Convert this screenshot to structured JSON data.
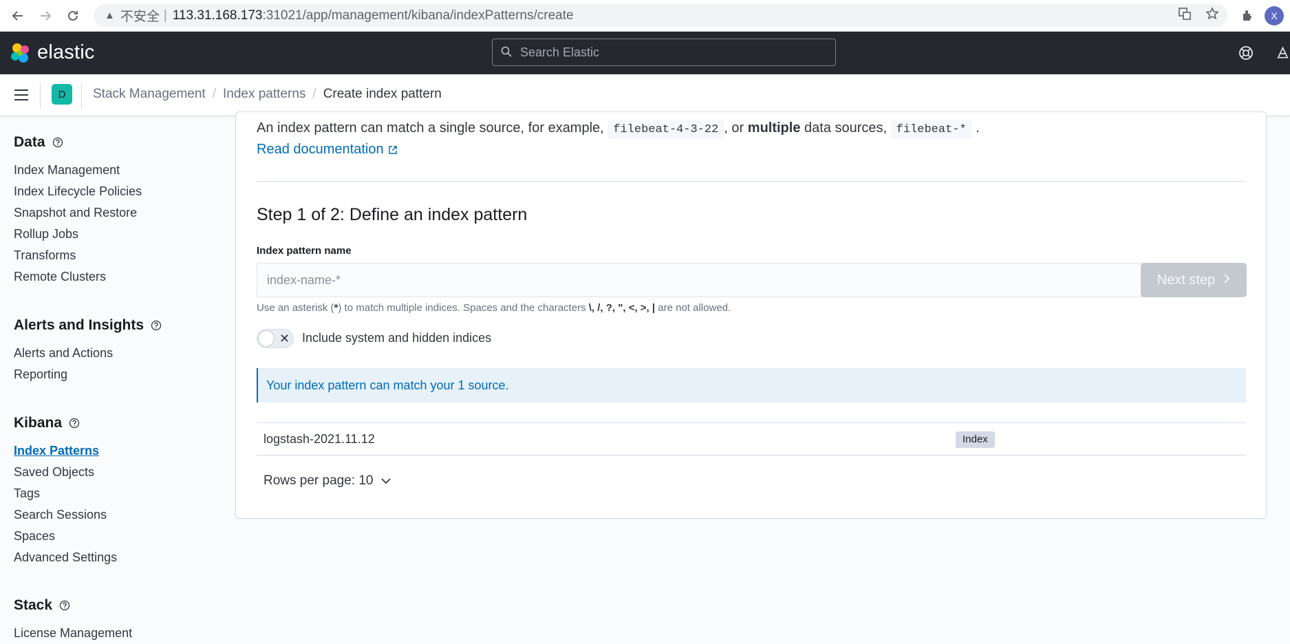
{
  "browser": {
    "warning_label": "不安全",
    "separator": "|",
    "url_host": "113.31.168.173",
    "url_path": ":31021/app/management/kibana/indexPatterns/create",
    "profile_initial": "X"
  },
  "header": {
    "brand": "elastic",
    "search_placeholder": "Search Elastic"
  },
  "breadcrumbs": {
    "space_initial": "D",
    "items": [
      "Stack Management",
      "Index patterns",
      "Create index pattern"
    ]
  },
  "sidebar": {
    "data": {
      "title": "Data",
      "items": [
        "Index Management",
        "Index Lifecycle Policies",
        "Snapshot and Restore",
        "Rollup Jobs",
        "Transforms",
        "Remote Clusters"
      ]
    },
    "alerts": {
      "title": "Alerts and Insights",
      "items": [
        "Alerts and Actions",
        "Reporting"
      ]
    },
    "kibana": {
      "title": "Kibana",
      "items": [
        "Index Patterns",
        "Saved Objects",
        "Tags",
        "Search Sessions",
        "Spaces",
        "Advanced Settings"
      ]
    },
    "stack": {
      "title": "Stack",
      "items": [
        "License Management"
      ]
    }
  },
  "panel": {
    "intro_part1": "An index pattern can match a single source, for example,",
    "intro_code1": "filebeat-4-3-22",
    "intro_part2": ", or",
    "intro_bold": "multiple",
    "intro_part3": "data sources,",
    "intro_code2": "filebeat-*",
    "intro_part4": ".",
    "read_docs": "Read documentation",
    "step_title": "Step 1 of 2: Define an index pattern",
    "field_label": "Index pattern name",
    "input_placeholder": "index-name-*",
    "input_value": "",
    "next_step": "Next step",
    "help_prefix": "Use an asterisk (",
    "help_asterisk": "*",
    "help_middle": ") to match multiple indices. Spaces and the characters",
    "help_chars": "\\, /, ?, \", <, >, |",
    "help_suffix": "are not allowed.",
    "toggle_label": "Include system and hidden indices",
    "toggle_on": false,
    "callout": "Your index pattern can match your 1 source.",
    "table_rows": [
      {
        "name": "logstash-2021.11.12",
        "type": "Index"
      }
    ],
    "rows_per_page": "Rows per page: 10"
  }
}
